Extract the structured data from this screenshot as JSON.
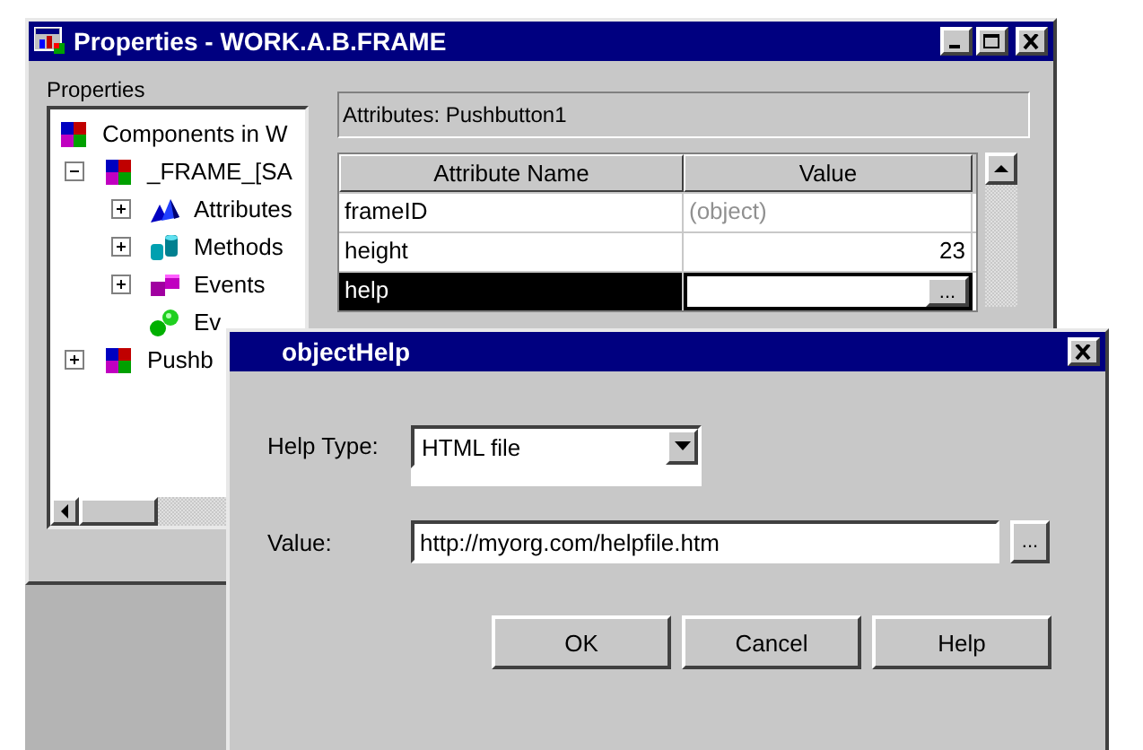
{
  "main_window": {
    "title": "Properties - WORK.A.B.FRAME",
    "tree_label": "Properties",
    "tree": [
      {
        "label": "Components in W",
        "kind": "component",
        "children": [
          {
            "label": "_FRAME_[SA",
            "kind": "component",
            "expanded": true,
            "children": [
              {
                "label": "Attributes",
                "kind": "attributes",
                "expanded": false
              },
              {
                "label": "Methods",
                "kind": "methods",
                "expanded": false
              },
              {
                "label": "Events",
                "kind": "events",
                "expanded": false
              },
              {
                "label": "Ev",
                "kind": "handlers"
              }
            ]
          },
          {
            "label": "Pushb",
            "kind": "component",
            "expanded": false
          }
        ]
      }
    ],
    "attributes_header": "Attributes: Pushbutton1",
    "table": {
      "columns": [
        "Attribute Name",
        "Value"
      ],
      "rows": [
        {
          "name": "frameID",
          "value": "(object)",
          "kind": "object",
          "selected": false
        },
        {
          "name": "height",
          "value": "23",
          "kind": "number",
          "selected": false
        },
        {
          "name": "help",
          "button": "...",
          "kind": "button",
          "selected": true
        }
      ]
    }
  },
  "dialog": {
    "title": "objectHelp",
    "help_type": {
      "label": "Help Type:",
      "value": "HTML file"
    },
    "value": {
      "label": "Value:",
      "value": "http://myorg.com/helpfile.htm",
      "browse": "..."
    },
    "buttons": [
      "OK",
      "Cancel",
      "Help"
    ]
  }
}
